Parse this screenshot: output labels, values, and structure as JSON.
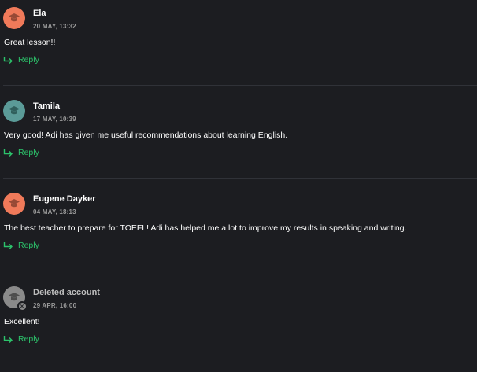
{
  "comments": [
    {
      "author": "Ela",
      "date": "20 MAY, 13:32",
      "text": "Great lesson!!",
      "avatar_color": "#f07a5a",
      "deleted": false
    },
    {
      "author": "Tamila",
      "date": "17 MAY, 10:39",
      "text": "Very good! Adi has given me useful recommendations about learning English.",
      "avatar_color": "#5b9b98",
      "deleted": false
    },
    {
      "author": "Eugene Dayker",
      "date": "04 MAY, 18:13",
      "text": "The best teacher to prepare for TOEFL! Adi has helped me a lot to improve my results in speaking and writing.",
      "avatar_color": "#f07a5a",
      "deleted": false
    },
    {
      "author": "Deleted account",
      "date": "29 APR, 16:00",
      "text": "Excellent!",
      "avatar_color": "#8a8a8a",
      "deleted": true
    }
  ],
  "reply_label": "Reply",
  "icons": {
    "avatar": "graduation-cap-icon",
    "reply": "reply-arrow-icon",
    "deleted_badge": "close-icon"
  }
}
